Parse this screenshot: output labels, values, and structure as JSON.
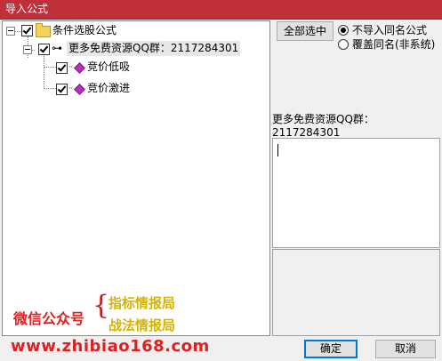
{
  "window": {
    "title": "导入公式",
    "title_bar_color": "#c0303a"
  },
  "tree": {
    "root": {
      "label": "条件选股公式",
      "icon": "folder-icon",
      "checked": true
    },
    "group": {
      "label": "更多免费资源QQ群：2117284301",
      "icon": "key-icon",
      "checked": true
    },
    "items": [
      {
        "label": "竞价低吸",
        "icon": "diamond-icon",
        "checked": true
      },
      {
        "label": "竞价激进",
        "icon": "diamond-icon",
        "checked": true
      }
    ]
  },
  "options": {
    "select_all_label": "全部选中",
    "radio_options": [
      {
        "label": "不导入同名公式",
        "selected": true
      },
      {
        "label": "覆盖同名(非系统)",
        "selected": false
      }
    ]
  },
  "info": {
    "text": "更多免费资源QQ群：2117284301"
  },
  "footer": {
    "ok_label": "确定",
    "cancel_label": "取消"
  },
  "watermark": {
    "wechat_label": "微信公众号",
    "brand1": "指标情报局",
    "brand2": "战法情报局",
    "url": "www.zhibiao168.com",
    "brace": "{"
  }
}
